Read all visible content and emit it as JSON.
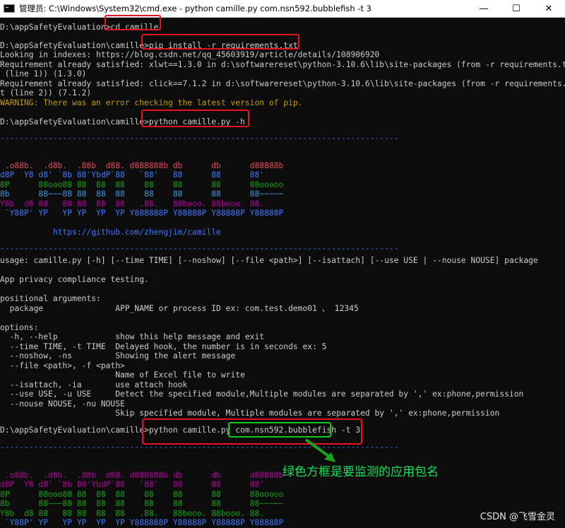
{
  "window": {
    "title": "管理员: C:\\Windows\\System32\\cmd.exe - python  camille.py com.nsn592.bubblefish -t 3",
    "minimize": "—",
    "maximize": "☐",
    "close": "✕"
  },
  "console": {
    "cmd1": "D:\\appSafetyEvaluation>cd camille",
    "cmd2": "D:\\appSafetyEvaluation\\camille>pip install -r requirements.txt",
    "out1": "Looking in indexes: https://blog.csdn.net/qq_45603919/article/details/108906920",
    "out2": "Requirement already satisfied: xlwt==1.3.0 in d:\\softwarereset\\python-3.10.6\\lib\\site-packages (from -r requirements.txt",
    "out3": " (line 1)) (1.3.0)",
    "out4": "Requirement already satisfied: click==7.1.2 in d:\\softwarereset\\python-3.10.6\\lib\\site-packages (from -r requirements.tx",
    "out5": "t (line 2)) (7.1.2)",
    "warning": "WARNING: There was an error checking the latest version of pip.",
    "cmd3": "D:\\appSafetyEvaluation\\camille>python camille.py -h",
    "dashes": "-----------------------------------------------------------------------------------",
    "banner": [
      " .o88b.  .d8b.  .88b  d88. d888888b db      db      d88888b",
      "d8P  Y8 d8' `8b 88'YbdP`88   `88'   88      88      88'",
      "8P      88ooo88 88  88  88    88    88      88      88ooooo",
      "8b      88~~~88 88  88  88    88    88      88      88~~~~~",
      "Y8b  d8 88   88 88  88  88   .88.   88booo. 88booo. 88.",
      " `Y88P' YP   YP YP  YP  YP Y888888P Y88888P Y88888P Y88888P"
    ],
    "github": "           https://github.com/zhengjim/camille",
    "usage": "usage: camille.py [-h] [--time TIME] [--noshow] [--file <path>] [--isattach] [--use USE | --nouse NOUSE] package",
    "desc": "App privacy compliance testing.",
    "positional_header": "positional arguments:",
    "positional_package": "  package               APP_NAME or process ID ex: com.test.demo01 、 12345",
    "options_header": "options:",
    "options": [
      "  -h, --help            show this help message and exit",
      "  --time TIME, -t TIME  Delayed hook, the number is in seconds ex: 5",
      "  --noshow, -ns         Showing the alert message",
      "  --file <path>, -f <path>",
      "                        Name of Excel file to write",
      "  --isattach, -ia       use attach hook",
      "  --use USE, -u USE     Detect the specified module,Multiple modules are separated by ',' ex:phone,permission",
      "  --nouse NOUSE, -nu NOUSE",
      "                        Skip specified module, Multiple modules are separated by ',' ex:phone,permission"
    ],
    "cmd4_prefix": "D:\\appSafetyEvaluation\\camille>",
    "cmd4_python": "python camille.py ",
    "cmd4_package": "com.nsn592.bubblefish",
    "cmd4_suffix": " -t 3"
  },
  "annotation": "绿色方框是要监测的应用包名",
  "watermark": "CSDN @飞雪金灵",
  "colors": {
    "background": "#0c0c0c",
    "text": "#cccccc",
    "warning": "#c19c00",
    "link_blue": "#3b78ff",
    "highlight_red": "#e81123",
    "highlight_green": "#19c519",
    "annotation_green": "#13e25a"
  }
}
